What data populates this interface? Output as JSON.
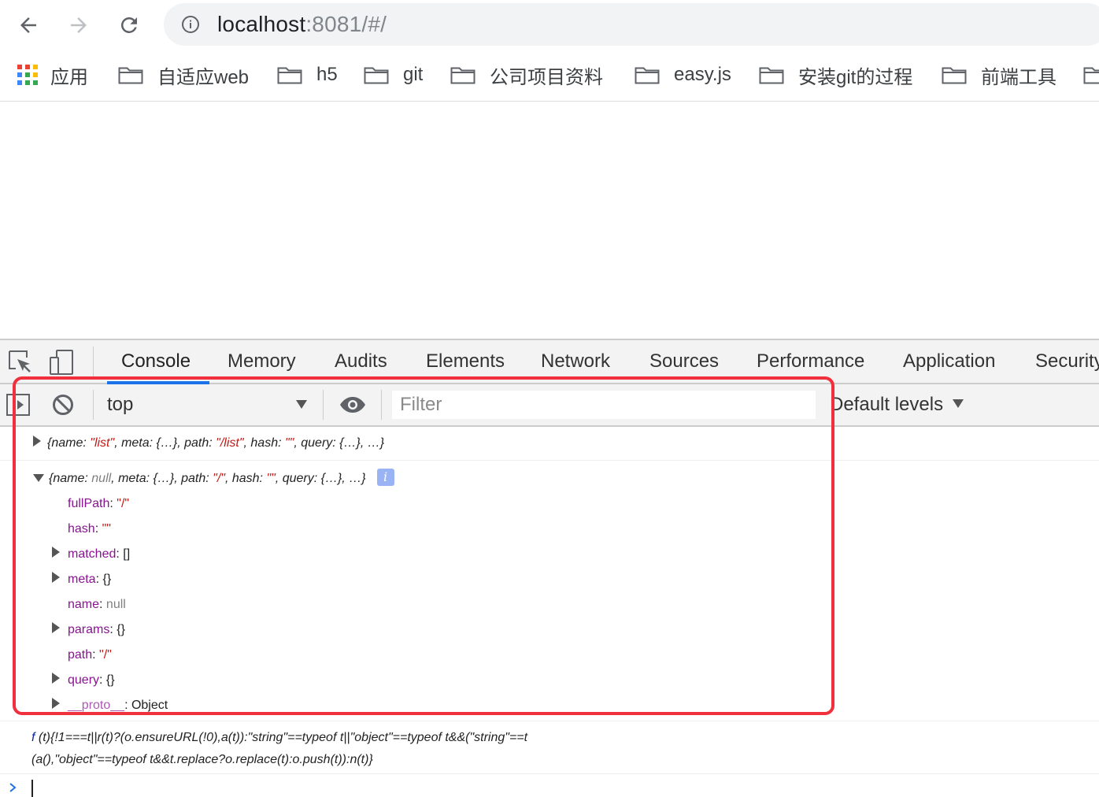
{
  "browser": {
    "url_host": "localhost",
    "url_rest": ":8081/#/",
    "bookmarks": [
      {
        "label": "应用",
        "icon": "apps-grid-icon"
      },
      {
        "label": "自适应web",
        "icon": "folder-icon"
      },
      {
        "label": "h5",
        "icon": "folder-icon"
      },
      {
        "label": "git",
        "icon": "folder-icon"
      },
      {
        "label": "公司项目资料",
        "icon": "folder-icon"
      },
      {
        "label": "easy.js",
        "icon": "folder-icon"
      },
      {
        "label": "安装git的过程",
        "icon": "folder-icon"
      },
      {
        "label": "前端工具",
        "icon": "folder-icon"
      }
    ]
  },
  "devtools": {
    "tabs": [
      "Console",
      "Memory",
      "Audits",
      "Elements",
      "Network",
      "Sources",
      "Performance",
      "Application",
      "Security"
    ],
    "active_tab": "Console",
    "context": "top",
    "filter_placeholder": "Filter",
    "levels": "Default levels"
  },
  "console": {
    "msg1": {
      "open": "{",
      "k1": "name",
      "c1": ": ",
      "v1": "\"list\"",
      "sep1": ", ",
      "k2": "meta",
      "c2": ": ",
      "v2": "{…}",
      "sep2": ", ",
      "k3": "path",
      "c3": ": ",
      "v3": "\"/list\"",
      "sep3": ", ",
      "k4": "hash",
      "c4": ": ",
      "v4": "\"\"",
      "sep4": ", ",
      "k5": "query",
      "c5": ": ",
      "v5": "{…}",
      "sep5": ", ",
      "rest": "…}"
    },
    "msg2": {
      "open": "{",
      "k1": "name",
      "c1": ": ",
      "v1": "null",
      "sep1": ", ",
      "k2": "meta",
      "c2": ": ",
      "v2": "{…}",
      "sep2": ", ",
      "k3": "path",
      "c3": ": ",
      "v3": "\"/\"",
      "sep3": ", ",
      "k4": "hash",
      "c4": ": ",
      "v4": "\"\"",
      "sep4": ", ",
      "k5": "query",
      "c5": ": ",
      "v5": "{…}",
      "sep5": ", ",
      "rest": "…}",
      "info_badge": "i",
      "props": [
        {
          "key": "fullPath",
          "value": "\"/\""
        },
        {
          "key": "hash",
          "value": "\"\""
        },
        {
          "key": "matched",
          "value": "[]"
        },
        {
          "key": "meta",
          "value": "{}"
        },
        {
          "key": "name",
          "value": "null"
        },
        {
          "key": "params",
          "value": "{}"
        },
        {
          "key": "path",
          "value": "\"/\""
        },
        {
          "key": "query",
          "value": "{}"
        },
        {
          "key": "__proto__",
          "value": "Object"
        }
      ]
    },
    "fn_line1": " (t){!1===t||r(t)?(o.ensureURL(!0),a(t)):\"string\"==typeof t||\"object\"==typeof t&&(\"string\"==t",
    "fn_line2": "(a(),\"object\"==typeof t&&t.replace?o.replace(t):o.push(t)):n(t)}",
    "fn_prefix": "f"
  },
  "colors": {
    "accent": "#1a73e8",
    "highlight": "#f0303c",
    "key_purple": "#881391",
    "string_red": "#c41a16"
  }
}
